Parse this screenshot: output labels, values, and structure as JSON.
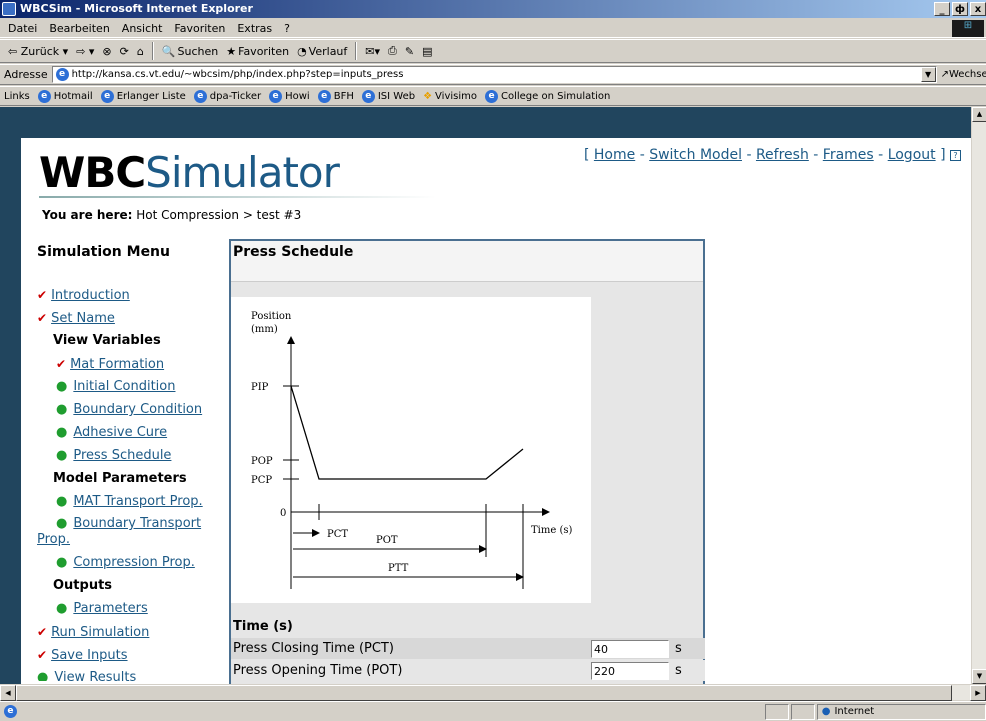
{
  "window": {
    "title": "WBCSim - Microsoft Internet Explorer",
    "ctrls": [
      "_",
      "ф",
      "x"
    ]
  },
  "menubar": {
    "items": [
      "Datei",
      "Bearbeiten",
      "Ansicht",
      "Favoriten",
      "Extras",
      "?"
    ]
  },
  "toolbar": {
    "back": "⇦ Zurück ▾",
    "forward": "⇨ ▾",
    "search": "Suchen",
    "favorites": "Favoriten",
    "history": "Verlauf"
  },
  "address": {
    "label": "Adresse",
    "url": "http://kansa.cs.vt.edu/~wbcsim/php/index.php?step=inputs_press",
    "go": "Wechseln zu"
  },
  "links": {
    "label": "Links",
    "items": [
      "Hotmail",
      "Erlanger Liste",
      "dpa-Ticker",
      "Howi",
      "BFH",
      "ISI Web",
      "Vivisimo",
      "College on Simulation"
    ]
  },
  "site": {
    "logo_bold": "WBC",
    "logo_rest": "Simulator",
    "toplinks": {
      "open": "[",
      "home": "Home",
      "switch_model": "Switch Model",
      "refresh": "Refresh",
      "frames": "Frames",
      "logout": "Logout",
      "close": "]",
      "sep": "-",
      "help": "?"
    },
    "crumb_label": "You are here:",
    "crumb_path": "Hot Compression > test #3"
  },
  "menu": {
    "title": "Simulation Menu",
    "introduction": "Introduction",
    "set_name": "Set Name",
    "view_variables": "View Variables",
    "mat_formation": "Mat Formation",
    "initial_condition": "Initial Condition",
    "boundary_condition": "Boundary Condition",
    "adhesive_cure": "Adhesive Cure",
    "press_schedule": "Press Schedule",
    "model_parameters": "Model Parameters",
    "mat_transport": "MAT Transport Prop.",
    "boundary_transport": "Boundary Transport Prop.",
    "compression_prop": "Compression Prop.",
    "outputs": "Outputs",
    "parameters": "Parameters",
    "run_simulation": "Run Simulation",
    "save_inputs": "Save Inputs",
    "view_results": "View Results"
  },
  "panel": {
    "title": "Press Schedule",
    "diagram": {
      "y_label_1": "Position",
      "y_label_2": "(mm)",
      "pip": "PIP",
      "pop": "POP",
      "pcp": "PCP",
      "zero": "0",
      "x_label": "Time (s)",
      "pct": "PCT",
      "pot": "POT",
      "ptt": "PTT"
    },
    "time_header": "Time (s)",
    "fields": [
      {
        "label": "Press Closing Time (PCT)",
        "value": "40",
        "unit": "s"
      },
      {
        "label": "Press Opening Time (POT)",
        "value": "220",
        "unit": "s"
      }
    ]
  },
  "status": {
    "zone": "Internet"
  }
}
